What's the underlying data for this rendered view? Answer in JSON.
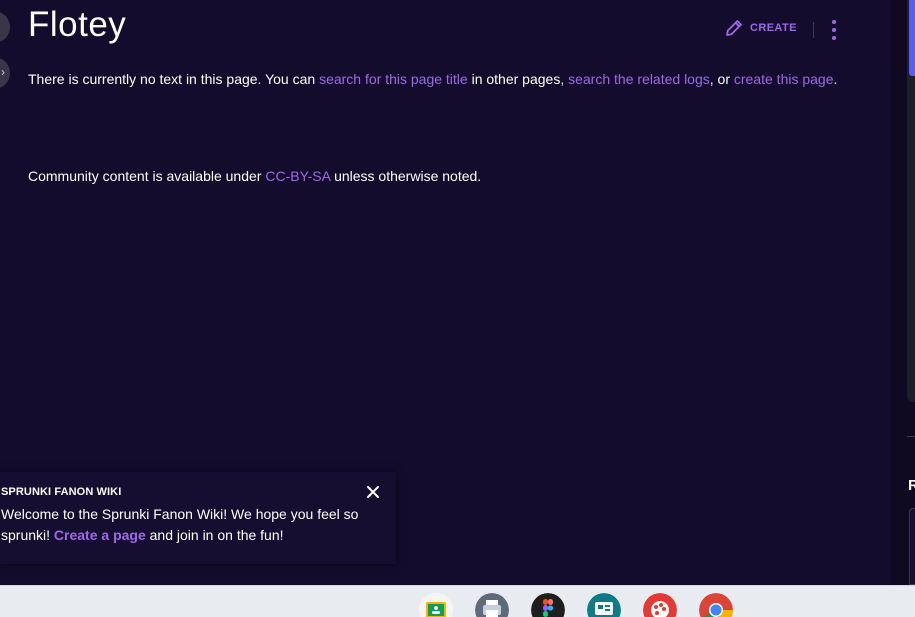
{
  "page": {
    "title": "Flotey",
    "actions": {
      "create_label": "CREATE",
      "more_icon": "more-vertical-icon",
      "create_icon": "pencil-icon"
    },
    "no_text": {
      "intro": "There is currently no text in this page. You can ",
      "link_search_title": "search for this page title",
      "mid_1": " in other pages, ",
      "link_search_logs": "search the related logs",
      "mid_2": ", or ",
      "link_create": "create this page",
      "end": "."
    },
    "license": {
      "pre": "Community content is available under ",
      "link": "CC-BY-SA",
      "post": " unless otherwise noted."
    }
  },
  "right_rail": {
    "heading_letter": "R"
  },
  "banner": {
    "title": "SPRUNKI FANON WIKI",
    "text_pre": "Welcome to the Sprunki Fanon Wiki! We hope you feel so sprunki! ",
    "link": "Create a page",
    "text_post": " and join in on the fun!",
    "close_icon": "close-icon"
  },
  "taskbar": {
    "apps": [
      {
        "name": "google-classroom-icon"
      },
      {
        "name": "printer-icon"
      },
      {
        "name": "figma-icon"
      },
      {
        "name": "slides-icon"
      },
      {
        "name": "paint-palette-icon"
      },
      {
        "name": "chrome-icon"
      }
    ]
  },
  "colors": {
    "background": "#130c2c",
    "accent": "#a068e8",
    "rail_accent": "#5b5df0",
    "taskbar": "#e8ebef"
  }
}
